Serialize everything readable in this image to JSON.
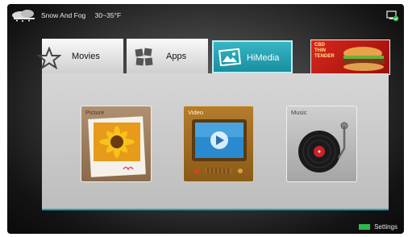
{
  "status": {
    "weather": "Snow And Fog",
    "temperature": "30~35°F",
    "weather_icon": "cloud-snow-icon",
    "network_icon": "network-status-icon"
  },
  "tabs": [
    {
      "label": "Movies",
      "icon": "star-icon",
      "selected": false
    },
    {
      "label": "Apps",
      "icon": "apps-grid-icon",
      "selected": false
    },
    {
      "label": "HiMedia",
      "icon": "picture-icon",
      "selected": true
    }
  ],
  "promo_banner": {
    "lines": [
      "CBD",
      "THIN",
      "TENDER"
    ],
    "image": "burger"
  },
  "media_cards": [
    {
      "title": "Picture",
      "icon": "sunflower-photo-icon"
    },
    {
      "title": "Video",
      "icon": "tv-play-icon"
    },
    {
      "title": "Music",
      "icon": "turntable-icon"
    }
  ],
  "footer": {
    "settings_label": "Settings",
    "settings_key_color": "#2fb84a"
  },
  "colors": {
    "accent": "#1a8fa0",
    "selected_tab": "#36b6c4"
  }
}
